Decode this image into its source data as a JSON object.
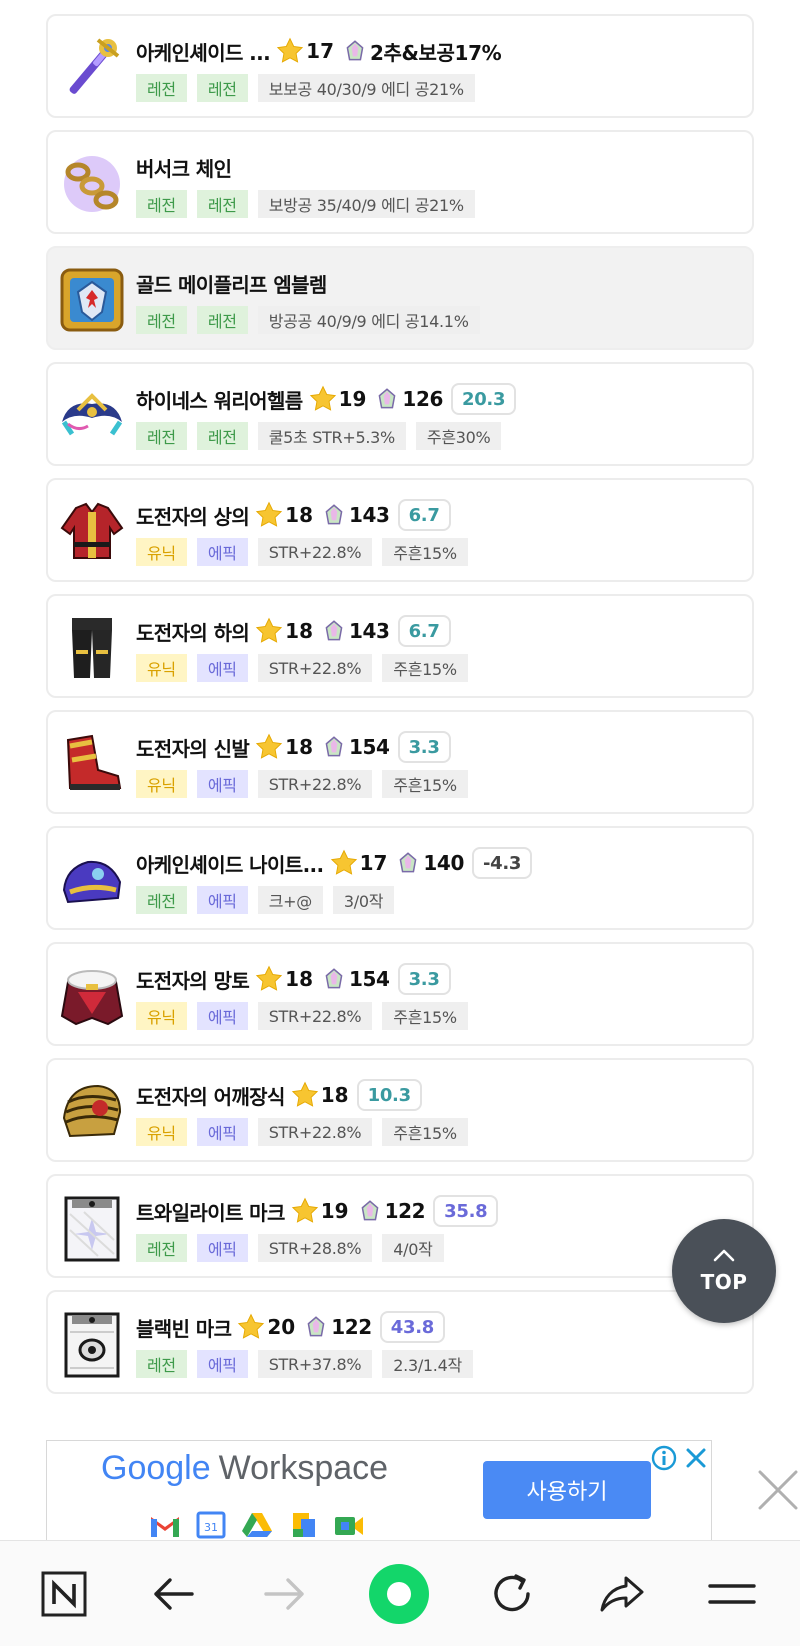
{
  "items": [
    {
      "name": "아케인셰이드 ...",
      "star": "17",
      "potential": "2추&보공17%",
      "score": "",
      "tags": [
        {
          "text": "레전",
          "kind": "leg"
        },
        {
          "text": "레전",
          "kind": "leg"
        },
        {
          "text": "보보공 40/30/9 에디 공21%",
          "kind": "opt"
        }
      ],
      "icon": "staff-icon",
      "highlighted": false
    },
    {
      "name": "버서크 체인",
      "star": "",
      "potential": "",
      "score": "",
      "tags": [
        {
          "text": "레전",
          "kind": "leg"
        },
        {
          "text": "레전",
          "kind": "leg"
        },
        {
          "text": "보방공 35/40/9 에디 공21%",
          "kind": "opt"
        }
      ],
      "icon": "chain-icon",
      "highlighted": false
    },
    {
      "name": "골드 메이플리프 엠블렘",
      "star": "",
      "potential": "",
      "score": "",
      "tags": [
        {
          "text": "레전",
          "kind": "leg"
        },
        {
          "text": "레전",
          "kind": "leg"
        },
        {
          "text": "방공공 40/9/9 에디 공14.1%",
          "kind": "opt"
        }
      ],
      "icon": "emblem-icon",
      "highlighted": true
    },
    {
      "name": "하이네스 워리어헬름",
      "star": "19",
      "potential": "126",
      "score": "20.3",
      "score_color": "#3a9aa0",
      "tags": [
        {
          "text": "레전",
          "kind": "leg"
        },
        {
          "text": "레전",
          "kind": "leg"
        },
        {
          "text": "쿨5초 STR+5.3%",
          "kind": "opt"
        },
        {
          "text": "주흔30%",
          "kind": "opt"
        }
      ],
      "icon": "helm-icon",
      "highlighted": false
    },
    {
      "name": "도전자의 상의",
      "star": "18",
      "potential": "143",
      "score": "6.7",
      "score_color": "#3a9aa0",
      "tags": [
        {
          "text": "유닉",
          "kind": "uni"
        },
        {
          "text": "에픽",
          "kind": "epi"
        },
        {
          "text": "STR+22.8%",
          "kind": "opt"
        },
        {
          "text": "주흔15%",
          "kind": "opt"
        }
      ],
      "icon": "top-armor-icon",
      "highlighted": false
    },
    {
      "name": "도전자의 하의",
      "star": "18",
      "potential": "143",
      "score": "6.7",
      "score_color": "#3a9aa0",
      "tags": [
        {
          "text": "유닉",
          "kind": "uni"
        },
        {
          "text": "에픽",
          "kind": "epi"
        },
        {
          "text": "STR+22.8%",
          "kind": "opt"
        },
        {
          "text": "주흔15%",
          "kind": "opt"
        }
      ],
      "icon": "pants-icon",
      "highlighted": false
    },
    {
      "name": "도전자의 신발",
      "star": "18",
      "potential": "154",
      "score": "3.3",
      "score_color": "#3a9aa0",
      "tags": [
        {
          "text": "유닉",
          "kind": "uni"
        },
        {
          "text": "에픽",
          "kind": "epi"
        },
        {
          "text": "STR+22.8%",
          "kind": "opt"
        },
        {
          "text": "주흔15%",
          "kind": "opt"
        }
      ],
      "icon": "shoes-icon",
      "highlighted": false
    },
    {
      "name": "아케인셰이드 나이트...",
      "star": "17",
      "potential": "140",
      "score": "-4.3",
      "score_color": "#444444",
      "tags": [
        {
          "text": "레전",
          "kind": "leg"
        },
        {
          "text": "에픽",
          "kind": "epi"
        },
        {
          "text": "크+@",
          "kind": "opt"
        },
        {
          "text": "3/0작",
          "kind": "opt"
        }
      ],
      "icon": "glove-icon",
      "highlighted": false
    },
    {
      "name": "도전자의 망토",
      "star": "18",
      "potential": "154",
      "score": "3.3",
      "score_color": "#3a9aa0",
      "tags": [
        {
          "text": "유닉",
          "kind": "uni"
        },
        {
          "text": "에픽",
          "kind": "epi"
        },
        {
          "text": "STR+22.8%",
          "kind": "opt"
        },
        {
          "text": "주흔15%",
          "kind": "opt"
        }
      ],
      "icon": "cape-icon",
      "highlighted": false
    },
    {
      "name": "도전자의 어깨장식",
      "star": "18",
      "potential": "",
      "score": "10.3",
      "score_color": "#3a9aa0",
      "tags": [
        {
          "text": "유닉",
          "kind": "uni"
        },
        {
          "text": "에픽",
          "kind": "epi"
        },
        {
          "text": "STR+22.8%",
          "kind": "opt"
        },
        {
          "text": "주흔15%",
          "kind": "opt"
        }
      ],
      "icon": "shoulder-icon",
      "highlighted": false
    },
    {
      "name": "트와일라이트 마크",
      "star": "19",
      "potential": "122",
      "score": "35.8",
      "score_color": "#6a6ad9",
      "tags": [
        {
          "text": "레전",
          "kind": "leg"
        },
        {
          "text": "에픽",
          "kind": "epi"
        },
        {
          "text": "STR+28.8%",
          "kind": "opt"
        },
        {
          "text": "4/0작",
          "kind": "opt"
        }
      ],
      "icon": "twilight-mark-icon",
      "highlighted": false
    },
    {
      "name": "블랙빈 마크",
      "star": "20",
      "potential": "122",
      "score": "43.8",
      "score_color": "#6a6ad9",
      "tags": [
        {
          "text": "레전",
          "kind": "leg"
        },
        {
          "text": "에픽",
          "kind": "epi"
        },
        {
          "text": "STR+37.8%",
          "kind": "opt"
        },
        {
          "text": "2.3/1.4작",
          "kind": "opt"
        }
      ],
      "icon": "blackbean-mark-icon",
      "highlighted": false
    }
  ],
  "top_button": {
    "label": "TOP"
  },
  "ad": {
    "brand_google": "Google",
    "brand_workspace": "Workspace",
    "cta": "사용하기"
  },
  "bottom_nav": [
    "naver-home-icon",
    "back-arrow-icon",
    "forward-arrow-icon",
    "green-dot-icon",
    "refresh-icon",
    "share-icon",
    "menu-icon"
  ],
  "colors": {
    "legendary": "#3e9a4a",
    "unique": "#d9a100",
    "epic": "#6a6ad9",
    "score_teal": "#3a9aa0",
    "top_button": "#4a5058",
    "ad_cta": "#4a8af4"
  }
}
